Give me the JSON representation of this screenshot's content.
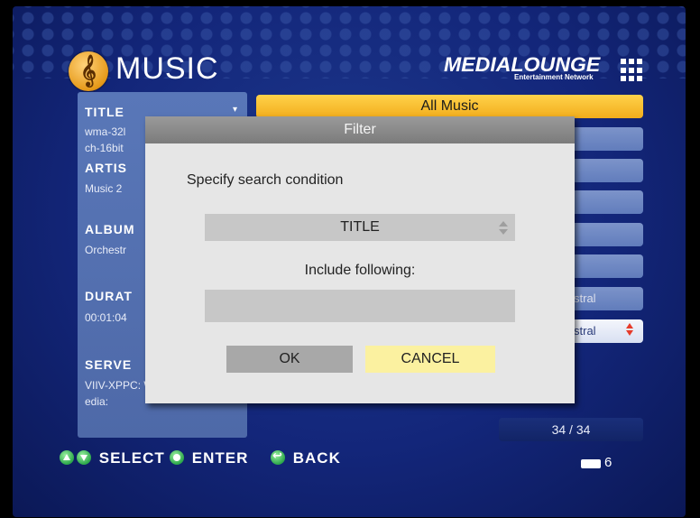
{
  "header": {
    "app_title": "MUSIC",
    "app_icon": "music-note-icon",
    "brand_name": "MEDIALOUNGE",
    "brand_subtitle": "Entertainment Network",
    "brand_trademark": "™"
  },
  "info_panel": {
    "title_label": "TITLE",
    "title_values": [
      "wma-32l",
      "ch-16bit"
    ],
    "artist_label": "ARTIS",
    "artist_value": "Music 2",
    "album_label": "ALBUM",
    "album_value": "Orchestr",
    "duration_label": "DURAT",
    "duration_value": "00:01:04",
    "server_label": "SERVE",
    "server_value": "VIIV-XPPC: WINXPM",
    "server_value2": "edia:"
  },
  "list": {
    "selected_label": "All Music",
    "row_partial_1": "stral",
    "row_partial_2": "stral"
  },
  "page_counter": "34 / 34",
  "footer": {
    "select_label": "SELECT",
    "enter_label": "ENTER",
    "back_label": "BACK",
    "battery_count": "6"
  },
  "dialog": {
    "title": "Filter",
    "prompt": "Specify search condition",
    "selected_condition": "TITLE",
    "include_label": "Include following:",
    "input_value": "",
    "ok_label": "OK",
    "cancel_label": "CANCEL"
  },
  "colors": {
    "background": "#13267a",
    "selected_row": "#f2ad1c",
    "dialog_bg": "#e6e6e6",
    "cancel_highlight": "#fbf1a0",
    "nav_green": "#2ca84a"
  }
}
